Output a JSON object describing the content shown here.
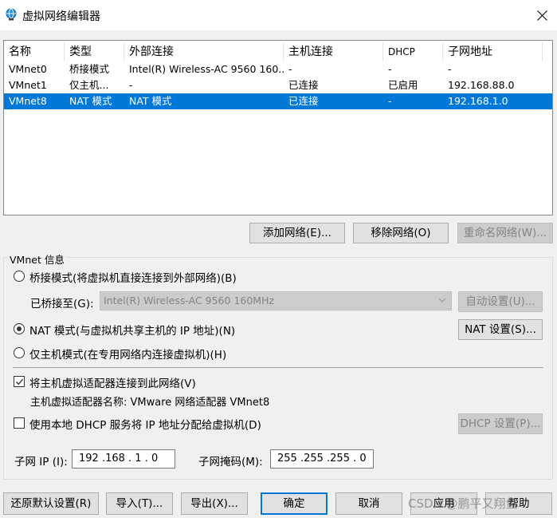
{
  "window": {
    "title": "虚拟网络编辑器",
    "icon": "network-globe-icon"
  },
  "table": {
    "columns": [
      "名称",
      "类型",
      "外部连接",
      "主机连接",
      "DHCP",
      "子网地址"
    ],
    "rows": [
      {
        "name": "VMnet0",
        "type": "桥接模式",
        "external": "Intel(R) Wireless-AC 9560 160...",
        "host": "-",
        "dhcp": "-",
        "subnet": "-"
      },
      {
        "name": "VMnet1",
        "type": "仅主机...",
        "external": "-",
        "host": "已连接",
        "dhcp": "已启用",
        "subnet": "192.168.88.0"
      },
      {
        "name": "VMnet8",
        "type": "NAT 模式",
        "external": "NAT 模式",
        "host": "已连接",
        "dhcp": "-",
        "subnet": "192.168.1.0"
      }
    ],
    "selected_row": "VMnet8",
    "selection_color": "#0078d7"
  },
  "network_buttons": {
    "add": "添加网络(E)...",
    "remove": "移除网络(O)",
    "rename": "重命名网络(W)..."
  },
  "vmnet_info": {
    "group_label": "VMnet 信息",
    "bridged_radio": "桥接模式(将虚拟机直接连接到外部网络)(B)",
    "bridged_to_label": "已桥接至(G):",
    "bridged_to_value": "Intel(R) Wireless-AC 9560 160MHz",
    "auto_settings": "自动设置(U)...",
    "nat_radio": "NAT 模式(与虚拟机共享主机的 IP 地址)(N)",
    "nat_settings": "NAT 设置(S)...",
    "hostonly_radio": "仅主机模式(在专用网络内连接虚拟机)(H)",
    "selected_mode": "nat",
    "connect_adapter_checkbox": "将主机虚拟适配器连接到此网络(V)",
    "connect_adapter_checked": true,
    "adapter_name_label": "主机虚拟适配器名称: VMware 网络适配器 VMnet8",
    "dhcp_checkbox": "使用本地 DHCP 服务将 IP 地址分配给虚拟机(D)",
    "dhcp_checked": false,
    "dhcp_settings": "DHCP 设置(P)...",
    "subnet_ip_label": "子网 IP (I):",
    "subnet_ip_value": "192 .168 . 1 . 0",
    "subnet_mask_label": "子网掩码(M):",
    "subnet_mask_value": "255 .255 .255 . 0"
  },
  "footer": {
    "restore_defaults": "还原默认设置(R)",
    "import": "导入(T)...",
    "export": "导出(X)...",
    "ok": "确定",
    "cancel": "取消",
    "apply": "应用",
    "help": "帮助"
  },
  "watermark": "CSDN @鹏平又翔鱼"
}
